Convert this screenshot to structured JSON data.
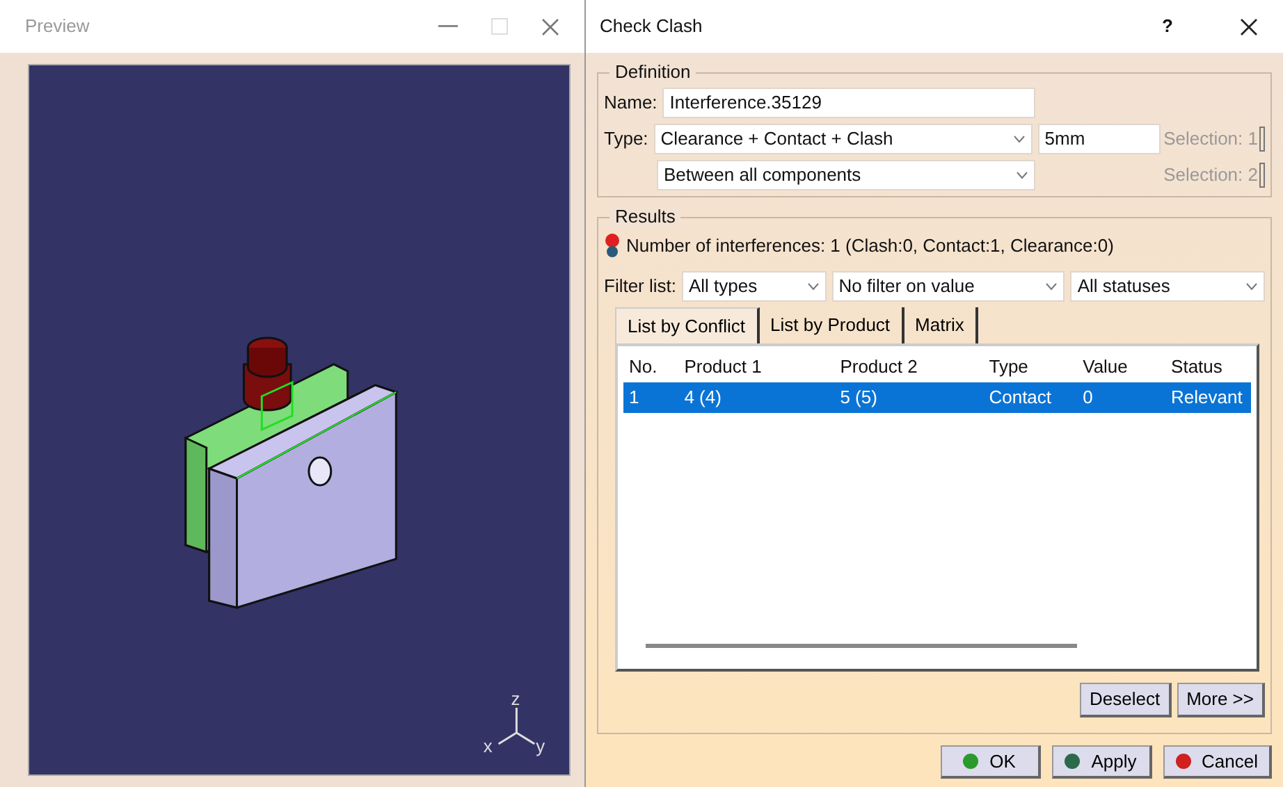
{
  "preview": {
    "title": "Preview",
    "axes": {
      "x": "x",
      "y": "y",
      "z": "z"
    }
  },
  "dialog": {
    "title": "Check Clash",
    "help": "?",
    "definition": {
      "legend": "Definition",
      "name_label": "Name:",
      "name_value": "Interference.35129",
      "type_label": "Type:",
      "type_value": "Clearance + Contact + Clash",
      "clearance_value": "5mm",
      "scope_value": "Between all components",
      "selection_1": "Selection: 1",
      "selection_2": "Selection: 2"
    },
    "results": {
      "legend": "Results",
      "summary": "Number of interferences: 1 (Clash:0, Contact:1, Clearance:0)",
      "filter_label": "Filter list:",
      "filters": [
        "All types",
        "No filter on value",
        "All statuses"
      ],
      "tabs": [
        {
          "label": "List by Conflict",
          "selected": true
        },
        {
          "label": "List by Product",
          "selected": false
        },
        {
          "label": "Matrix",
          "selected": false
        }
      ],
      "table": {
        "columns": [
          "No.",
          "Product 1",
          "Product 2",
          "Type",
          "Value",
          "Status"
        ],
        "rows": [
          {
            "cells": [
              "1",
              "4 (4)",
              "5 (5)",
              "Contact",
              "0",
              "Relevant"
            ],
            "selected": true
          }
        ]
      },
      "buttons": [
        "Deselect",
        "More >>"
      ]
    },
    "footer_buttons": [
      {
        "label": "OK",
        "color": "#2a9a2a"
      },
      {
        "label": "Apply",
        "color": "#2c6a4a"
      },
      {
        "label": "Cancel",
        "color": "#d02020"
      }
    ]
  }
}
